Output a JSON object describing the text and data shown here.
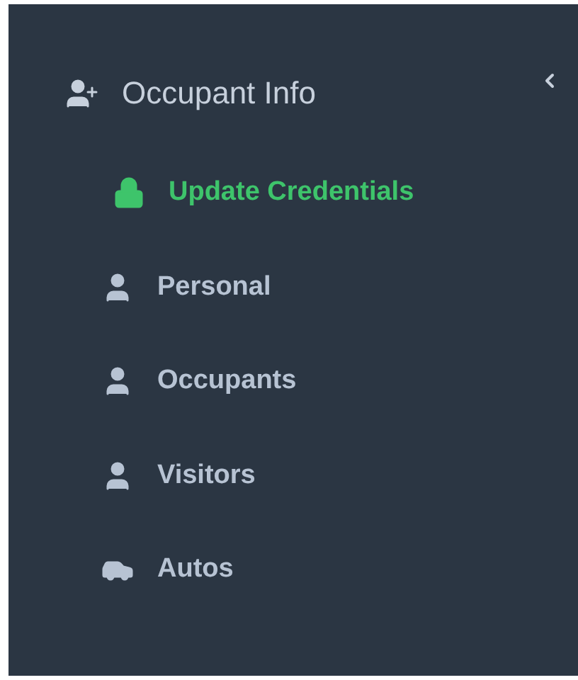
{
  "menu": {
    "title": "Occupant Info",
    "items": [
      {
        "label": "Update Credentials",
        "kind": "lock",
        "selected": true
      },
      {
        "label": "Personal",
        "kind": "person",
        "selected": false
      },
      {
        "label": "Occupants",
        "kind": "person",
        "selected": false
      },
      {
        "label": "Visitors",
        "kind": "person",
        "selected": false
      },
      {
        "label": "Autos",
        "kind": "vehicle",
        "selected": false
      }
    ]
  }
}
